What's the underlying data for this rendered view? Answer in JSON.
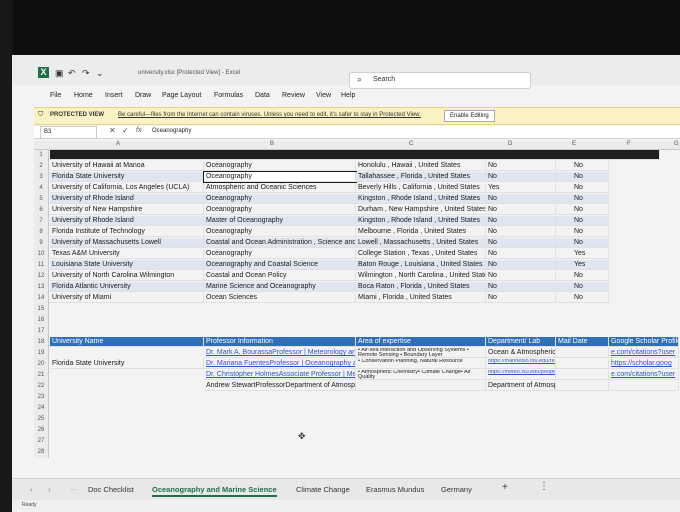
{
  "window": {
    "title": "university.xlsx [Protected View] - Excel",
    "search_placeholder": "Search"
  },
  "menu": [
    "File",
    "Home",
    "Insert",
    "Draw",
    "Page Layout",
    "Formulas",
    "Data",
    "Review",
    "View",
    "Help"
  ],
  "protected_view": {
    "label": "PROTECTED VIEW",
    "message": "Be careful—files from the Internet can contain viruses. Unless you need to edit, it's safer to stay in Protected View.",
    "button": "Enable Editing"
  },
  "formula_bar": {
    "name_box": "B3",
    "fx": "fx",
    "content": "Oceanography"
  },
  "columns": [
    "A",
    "B",
    "C",
    "D",
    "E",
    "F",
    "G"
  ],
  "rows": [
    {
      "n": "1",
      "cells": [
        "",
        "",
        "",
        "",
        ""
      ]
    },
    {
      "n": "2",
      "cells": [
        "University of Hawaii at Manoa",
        "Oceanography",
        "Honolulu , Hawaii , United States",
        "No",
        "No"
      ]
    },
    {
      "n": "3",
      "cells": [
        "Florida State University",
        "Oceanography",
        "Tallahassee , Florida , United States",
        "No",
        "No"
      ]
    },
    {
      "n": "4",
      "cells": [
        "University of California, Los Angeles (UCLA)",
        "Atmospheric and Oceanic Sciences",
        "Beverly Hills , California , United States",
        "Yes",
        "No"
      ]
    },
    {
      "n": "5",
      "cells": [
        "University of Rhode Island",
        "Oceanography",
        "Kingston , Rhode Island , United States",
        "No",
        "No"
      ]
    },
    {
      "n": "6",
      "cells": [
        "University of New Hampshire",
        "Oceanography",
        "Durham , New Hampshire , United States",
        "No",
        "No"
      ]
    },
    {
      "n": "7",
      "cells": [
        "University of Rhode Island",
        "Master of Oceanography",
        "Kingston , Rhode Island , United States",
        "No",
        "No"
      ]
    },
    {
      "n": "8",
      "cells": [
        "Florida Institute of Technology",
        "Oceanography",
        "Melbourne , Florida , United States",
        "No",
        "No"
      ]
    },
    {
      "n": "9",
      "cells": [
        "University of Massachusetts Lowell",
        "Coastal and Ocean Administration , Science and Technology",
        "Lowell , Massachusetts , United States",
        "No",
        "No"
      ]
    },
    {
      "n": "10",
      "cells": [
        "Texas A&M University",
        "Oceanography",
        "College Station , Texas , United States",
        "No",
        "Yes"
      ]
    },
    {
      "n": "11",
      "cells": [
        "Louisiana State University",
        "Oceanography and Coastal Science",
        "Baton Rouge , Louisiana , United States",
        "No",
        "Yes"
      ]
    },
    {
      "n": "12",
      "cells": [
        "University of North Carolina Wilmington",
        "Coastal and Ocean Policy",
        "Wilmington , North Carolina , United States",
        "No",
        "No"
      ]
    },
    {
      "n": "13",
      "cells": [
        "Florida Atlantic University",
        "Marine Science and Oceanography",
        "Boca Raton , Florida , United States",
        "No",
        "No"
      ]
    },
    {
      "n": "14",
      "cells": [
        "University of Miami",
        "Ocean Sciences",
        "Miami , Florida , United States",
        "No",
        "No"
      ]
    }
  ],
  "empty_rows": [
    "15",
    "16",
    "17"
  ],
  "table2": {
    "headers": [
      "University Name",
      "Professor Information",
      "Area of expertise",
      "Department/ Lab",
      "Mail Date",
      "Google Scholar Profile"
    ],
    "university": "Florida State University",
    "professors": [
      "Dr. Mark A. BourassaProfessor | Meteorology and Earth",
      "Dr. Mariana FuentesProfessor | Oceanography and",
      "Dr. Christopher HolmesAssociate Professor | Meteor",
      "Andrew StewartProfessorDepartment of Atmospheric"
    ],
    "expertise": [
      "• Air-sea interaction and Observing Systems • Remote Sensing • Boundary Layer",
      "• Conservation Planning, Natural Resource",
      "• Atmospheric Chemistry• Climate Change• Air Quality",
      ""
    ],
    "departments": [
      "Ocean & Atmospheric",
      "https://marinebio.fsu.edu/research/fuentes",
      "https://meteo.fsu.edu/people/holmes",
      "Department of Atmospheric"
    ],
    "scholar": [
      "e.com/citations?user",
      "https://scholar.goog",
      "e.com/citations?user",
      ""
    ],
    "row_numbers": [
      "18",
      "19",
      "20",
      "21",
      "22"
    ]
  },
  "trailing_rows": [
    "23",
    "24",
    "25",
    "26",
    "27",
    "28"
  ],
  "sheet_tabs": [
    "Doc Checklist",
    "Oceanography and Marine Science",
    "Climate Change",
    "Erasmus Mundus",
    "Germany"
  ],
  "active_tab": "Oceanography and Marine Science",
  "status": "Ready",
  "colors": {
    "header_fill": "#1f3864",
    "accent": "#1e7145",
    "band": "#dfe6f1"
  }
}
